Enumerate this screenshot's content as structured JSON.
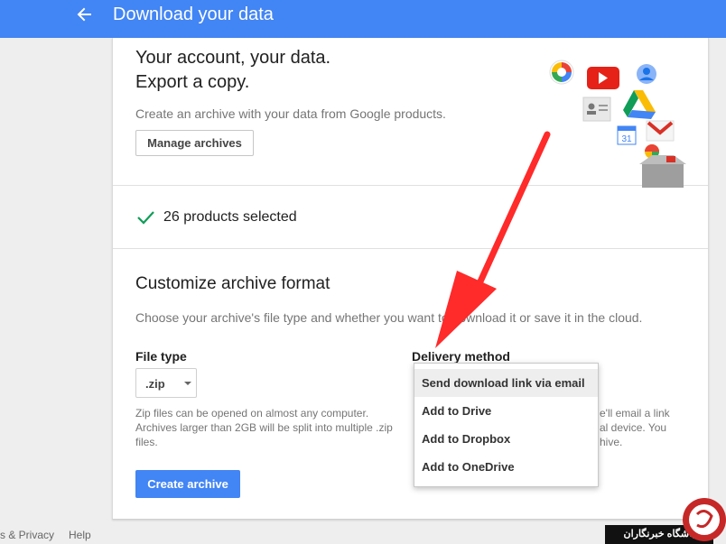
{
  "header": {
    "title": "Download your data",
    "back_icon": "arrow-back-icon"
  },
  "hero": {
    "title_line1": "Your account, your data.",
    "title_line2": "Export a copy.",
    "description": "Create an archive with your data from Google products.",
    "manage_button": "Manage archives"
  },
  "products": {
    "selected_text": "26 products selected"
  },
  "customize": {
    "title": "Customize archive format",
    "description": "Choose your archive's file type and whether you want to download it or save it in the cloud.",
    "file_type_label": "File type",
    "file_type_value": ".zip",
    "file_type_help": [
      "Zip files can be opened on almost any computer.",
      "Archives larger than 2GB will be split into multiple .zip",
      "files."
    ],
    "delivery_label": "Delivery method",
    "delivery_help_partial": [
      "e'll email a link",
      "al device. You",
      "hive."
    ],
    "create_button": "Create archive"
  },
  "delivery_dropdown": {
    "options": [
      "Send download link via email",
      "Add to Drive",
      "Add to Dropbox",
      "Add to OneDrive"
    ],
    "selected_index": 0
  },
  "footer": {
    "privacy": "s & Privacy",
    "help": "Help"
  },
  "watermark": {
    "text": "باشگاه خبرنگاران"
  },
  "colors": {
    "accent": "#4285f4",
    "check": "#0f9d58",
    "arrow": "#ff2a2a"
  }
}
